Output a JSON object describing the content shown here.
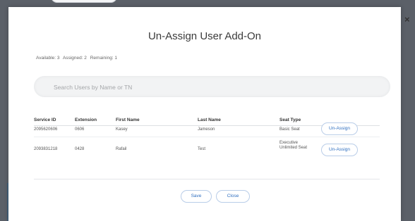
{
  "dialog": {
    "title": "Un-Assign User Add-On",
    "close_glyph": "×",
    "counts": {
      "available": "Available: 3",
      "assigned": "Assigned: 2",
      "remaining": "Remaining: 1"
    }
  },
  "search": {
    "placeholder": "Search Users by Name or TN",
    "value": ""
  },
  "table": {
    "columns": [
      "Service ID",
      "Extension",
      "First Name",
      "Last Name",
      "Seat Type"
    ],
    "rows": [
      {
        "service_id": "2095620606",
        "extension": "0606",
        "first_name": "Kasey",
        "last_name": "Jameson",
        "seat_type": "Basic Seat",
        "action": "Un-Assign"
      },
      {
        "service_id": "2093831218",
        "extension": "0428",
        "first_name": "Rafail",
        "last_name": "Test",
        "seat_type": "Executive Unlimited Seat",
        "action": "Un-Assign"
      }
    ]
  },
  "footer": {
    "save": "Save",
    "close": "Close"
  },
  "colors": {
    "accent": "#2f6fc0",
    "backdrop": "#5b6068",
    "surface": "#ffffff"
  }
}
